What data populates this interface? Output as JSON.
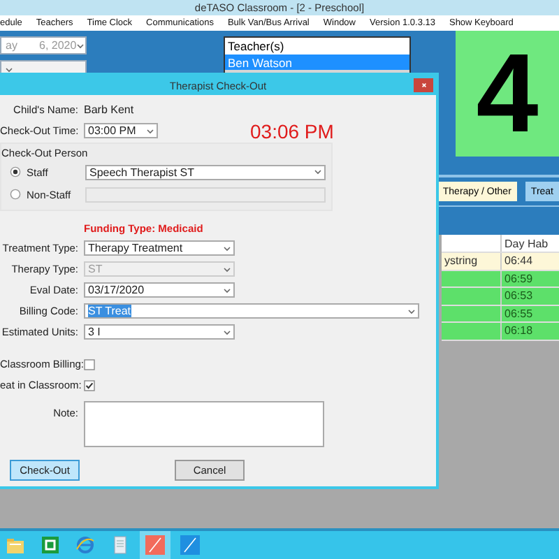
{
  "window": {
    "title": "deTASO Classroom - [2 - Preschool]"
  },
  "menu": [
    "edule",
    "Teachers",
    "Time Clock",
    "Communications",
    "Bulk Van/Bus Arrival",
    "Window",
    "Version 1.0.3.13",
    "Show Keyboard"
  ],
  "background": {
    "date_field": {
      "value": "ay       6, 2020"
    },
    "teachers": {
      "header": "Teacher(s)",
      "items": [
        {
          "label": "Ben Watson",
          "selected": true
        }
      ]
    },
    "count": "4",
    "tabs": [
      {
        "label": "Therapy / Other",
        "selected": true
      },
      {
        "label": "Treat",
        "selected": false
      }
    ],
    "table": {
      "column": "Day Hab",
      "rows": [
        {
          "name": "ystring",
          "time": "06:44",
          "selected": true
        },
        {
          "time": "06:59",
          "selected": false
        },
        {
          "time": "06:53",
          "selected": false
        },
        {
          "time": "06:55",
          "selected": false
        },
        {
          "time": "06:18",
          "selected": false
        }
      ]
    }
  },
  "dialog": {
    "title": "Therapist Check-Out",
    "child_name": {
      "label": "Child's Name:",
      "value": "Barb Kent"
    },
    "check_out_time": {
      "label": "Check-Out Time:",
      "value": "03:00 PM"
    },
    "clock": "03:06 PM",
    "person": {
      "label": "Check-Out Person",
      "options": [
        {
          "label": "Staff",
          "selected": true,
          "field": {
            "value": "Speech Therapist ST",
            "disabled": false
          }
        },
        {
          "label": "Non-Staff",
          "selected": false,
          "field": {
            "disabled": true
          }
        }
      ]
    },
    "funding": "Funding Type: Medicaid",
    "fields": [
      {
        "kind": "combo",
        "label": "Treatment Type:",
        "value": "Therapy Treatment",
        "disabled": false,
        "highlighted": false
      },
      {
        "kind": "combo",
        "label": "Therapy Type:",
        "value": "ST",
        "disabled": true,
        "highlighted": false
      },
      {
        "kind": "combo",
        "label": "Eval Date:",
        "value": "03/17/2020",
        "disabled": false,
        "highlighted": false
      },
      {
        "kind": "long-combo",
        "label": "Billing Code:",
        "value": "ST Treat",
        "disabled": false,
        "highlighted": true
      },
      {
        "kind": "combo",
        "label": "Estimated Units:",
        "value": "3 I",
        "disabled": false,
        "highlighted": false
      }
    ],
    "checks": [
      {
        "label": "Classroom Billing:",
        "checked": false
      },
      {
        "label": "eat in Classroom:",
        "checked": true
      }
    ],
    "note": {
      "label": "Note:"
    },
    "buttons": [
      {
        "label": "Check-Out",
        "kind": "default"
      },
      {
        "label": "Cancel",
        "kind": "normal"
      }
    ]
  },
  "taskbar": [
    {
      "kind": "folder",
      "active": false
    },
    {
      "kind": "green-app",
      "active": false
    },
    {
      "kind": "browser",
      "active": false
    },
    {
      "kind": "document",
      "active": false
    },
    {
      "kind": "red-app",
      "active": true
    },
    {
      "kind": "blue-app",
      "active": false
    }
  ]
}
